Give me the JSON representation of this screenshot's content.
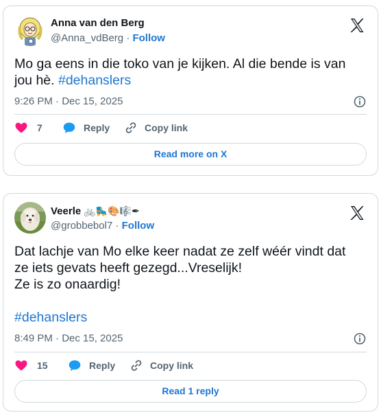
{
  "tweets": [
    {
      "name": "Anna van den Berg",
      "handle": "@Anna_vdBerg",
      "separator": "·",
      "follow_label": "Follow",
      "text_line1": "Mo ga eens in die toko van je kijken. Al die bende is van",
      "text_line2": "jou hè. ",
      "hashtag": "#dehanslers",
      "timestamp": "9:26 PM · Dec 15, 2025",
      "likes": "7",
      "reply_label": "Reply",
      "copy_label": "Copy link",
      "footer_button": "Read more on X"
    },
    {
      "name": "Veerle",
      "name_emojis": "🚲🛼🎨🎼✒",
      "handle": "@grobbebol7",
      "separator": "·",
      "follow_label": "Follow",
      "text_line1": "Dat lachje van Mo elke keer nadat ze zelf wéér vindt dat",
      "text_line2": "ze iets gevats heeft gezegd...Vreselijk!",
      "text_line3": "Ze is zo onaardig!",
      "hashtag": "#dehanslers",
      "timestamp": "8:49 PM · Dec 15, 2025",
      "likes": "15",
      "reply_label": "Reply",
      "copy_label": "Copy link",
      "footer_button": "Read 1 reply"
    }
  ],
  "colors": {
    "link": "#1d76d2",
    "heart": "#f91880",
    "reply_bubble": "#1d9bf0",
    "muted": "#536471",
    "border": "#cfd9de"
  },
  "icons": [
    "x-logo-icon",
    "info-icon",
    "heart-icon",
    "reply-bubble-icon",
    "link-icon"
  ]
}
